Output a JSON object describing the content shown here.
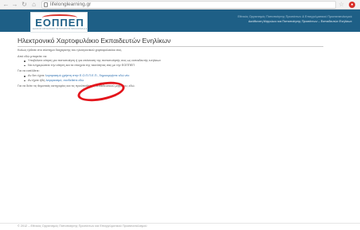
{
  "browser": {
    "url": "lifelonglearning.gr",
    "back_icon": "arrow-left-icon",
    "forward_icon": "arrow-right-icon",
    "reload_icon": "reload-icon",
    "home_icon": "home-icon"
  },
  "header": {
    "logo_text": "ΕΟΠΠΕΠ",
    "logo_subtitle": "ΕΘΝΙΚΟΣ ΟΡΓΑΝΙΣΜΟΣ ΠΙΣΤΟΠΟΙΗΣΗΣ ΠΡΟΣΟΝΤΩΝ & ΕΠΑΓΓΕΛΜΑΤΙΚΟΥ ΠΡΟΣΑΝΑΤΟΛΙΣΜΟΥ",
    "line1": "Εθνικός Οργανισμός Πιστοποίησης Προσόντων & Επαγγελματικού Προσανατολισμού",
    "line2": "Διεύθυνση Μητρώων και Πιστοποίησης Προσόντων – Εκπαιδευτών Ενηλίκων"
  },
  "main": {
    "title": "Ηλεκτρονικό Χαρτοφυλάκιο Εκπαιδευτών Ενηλίκων",
    "intro": "Καλώς ήλθατε στο σύστημα διαχείρισης του ηλεκτρονικού χαρτοφυλακίου σας.",
    "can_do": "Από εδώ μπορείτε να:",
    "bullets_can_do": [
      "Υποβάλετε αίτηση για πιστοποίηση ή για επέκταση της πιστοποίησής σας ως εκπαιδευτής ενηλίκων",
      "Να ενημερώσετε την αίτηση και τα στοιχεία της ταυτότητας σας με την ΕΟΠΠΕΠ"
    ],
    "to_enter": "Για να εισέλθετε:",
    "bullet_new_prefix": "Αν δεν έχετε",
    "bullet_new_middle": " λογαριασμό χρήστη στην Ε.Ο.Π.Π.Ε.Π., ",
    "bullet_new_link": "δημιουργήστε εδώ νέο",
    "bullet_existing_prefix": "Αν έχετε ήδη",
    "bullet_existing_link": " λογαριασμό, συνδεθείτε εδώ",
    "help": "Για να δείτε τις θεματικές κατηγορίες και τις προϋποθέσεις εκπαιδευτικού μητρώου, εδώ."
  },
  "footer": {
    "text": "© 2012 – Εθνικός Οργανισμός Πιστοποίησης Προσόντων και Επαγγελματικού Προσανατολισμού"
  },
  "colors": {
    "header_bg": "#1e5f86",
    "annotation": "#e3141b",
    "link": "#2a6eb0"
  }
}
